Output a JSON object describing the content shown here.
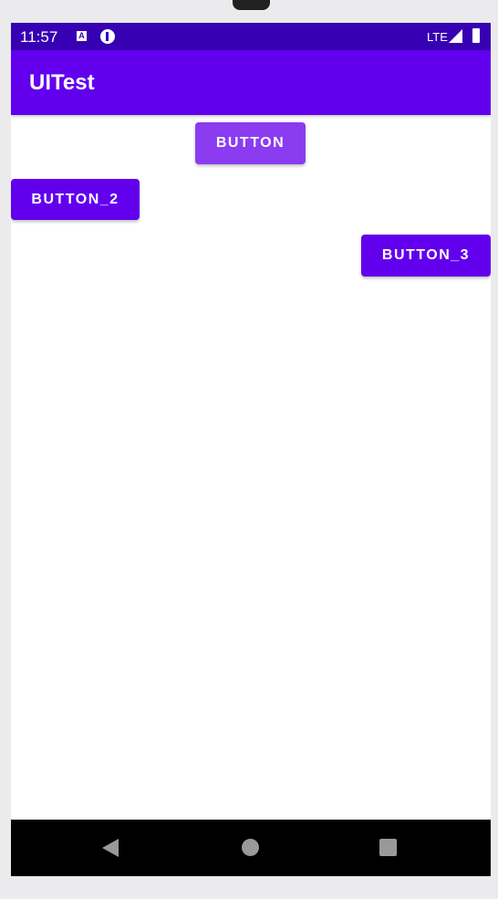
{
  "status_bar": {
    "time": "11:57",
    "network": "LTE",
    "icons": [
      "a-notification-icon",
      "p-notification-icon",
      "signal-icon",
      "battery-icon"
    ]
  },
  "app_bar": {
    "title": "UITest"
  },
  "buttons": [
    {
      "label": "BUTTON"
    },
    {
      "label": "BUTTON_2"
    },
    {
      "label": "BUTTON_3"
    }
  ],
  "colors": {
    "primary": "#6200ee",
    "primary_dark": "#3700b3",
    "pressed": "#8b3cf0"
  }
}
